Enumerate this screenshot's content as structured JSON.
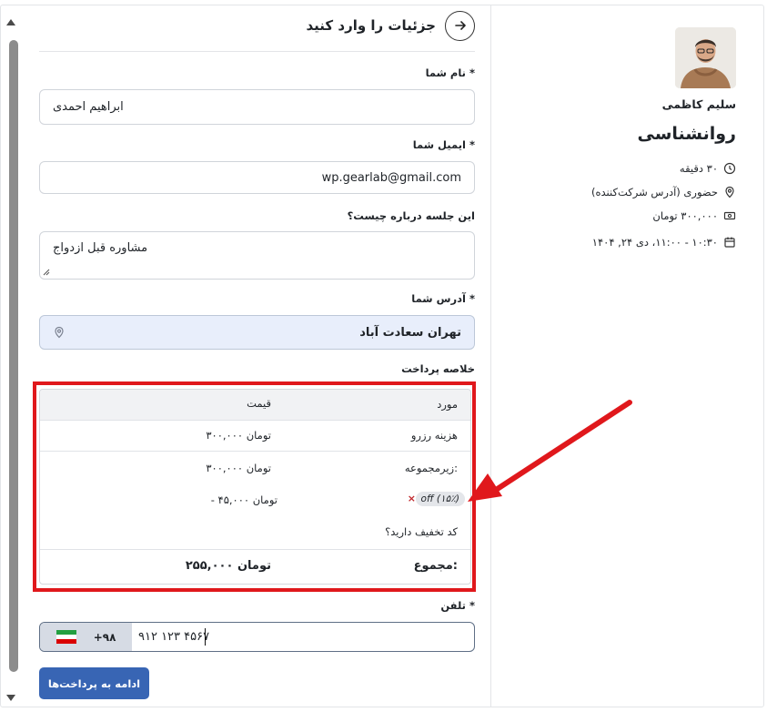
{
  "form": {
    "title": "جزئیات را وارد کنید",
    "name_label": "نام شما *",
    "name_value": "ابراهیم احمدی",
    "email_label": "ایمیل شما *",
    "email_value": "wp.gearlab@gmail.com",
    "notes_label": "این جلسه درباره چیست؟",
    "notes_value": "مشاوره قبل ازدواج",
    "address_label": "آدرس شما *",
    "address_value": "تهران سعادت آباد",
    "summary_label": "خلاصه پرداخت",
    "phone_label": "تلفن *",
    "phone_code": "+۹۸",
    "phone_value": "۹۱۲ ۱۲۳ ۴۵۶۷",
    "submit_label": "ادامه به پرداخت‌ها"
  },
  "summary": {
    "col_item": "مورد",
    "col_price": "قیمت",
    "row_fee_label": "هزینه رزرو",
    "row_fee_value": "۳۰۰,۰۰۰ تومان",
    "subtotal_label": "زیرمجموعه:",
    "subtotal_value": "۳۰۰,۰۰۰ تومان",
    "discount_pill": "off (۱۵٪)",
    "discount_remove": "×",
    "discount_value": "- ۴۵,۰۰۰ تومان",
    "coupon_prompt": "کد تخفیف دارید؟",
    "total_label": "مجموع:",
    "total_value": "۲۵۵,۰۰۰ تومان"
  },
  "sidebar": {
    "host_name": "سلیم کاظمی",
    "event_title": "روانشناسی",
    "duration": "۳۰ دقیقه",
    "location": "حضوری (آدرس شرکت‌کننده)",
    "price": "۳۰۰,۰۰۰ تومان",
    "datetime": "۱۰:۳۰ - ۱۱:۰۰، دی ۲۴, ۱۴۰۴"
  },
  "colors": {
    "primary": "#3865b4",
    "highlight_red": "#e0181c",
    "address_bg": "#e8eefb",
    "flag_green": "#239f40",
    "flag_red": "#da0000"
  },
  "icons": {
    "back": "arrow-right-icon",
    "duration": "clock-icon",
    "location": "map-pin-icon",
    "price": "money-icon",
    "datetime": "calendar-icon",
    "address": "map-pin-icon"
  }
}
